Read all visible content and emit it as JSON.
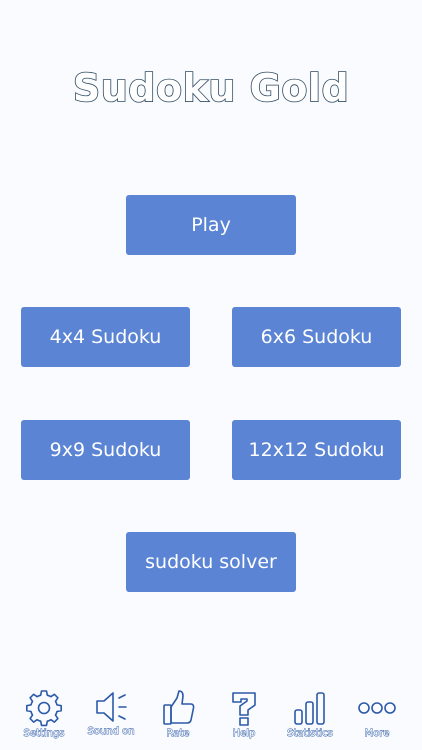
{
  "app": {
    "title": "Sudoku Gold"
  },
  "menu": {
    "play": "Play",
    "sudoku_4x4": "4x4 Sudoku",
    "sudoku_6x6": "6x6 Sudoku",
    "sudoku_9x9": "9x9 Sudoku",
    "sudoku_12x12": "12x12 Sudoku",
    "solver": "sudoku solver"
  },
  "toolbar": {
    "items": [
      {
        "label": "Settings",
        "icon": "gear-icon"
      },
      {
        "label": "Sound on",
        "icon": "speaker-icon"
      },
      {
        "label": "Rate",
        "icon": "thumbs-up-icon"
      },
      {
        "label": "Help",
        "icon": "question-mark-icon"
      },
      {
        "label": "Statistics",
        "icon": "bar-chart-icon"
      },
      {
        "label": "More",
        "icon": "more-dots-icon"
      }
    ]
  },
  "colors": {
    "background": "#f9fbfe",
    "button": "#5b84d4",
    "button_text": "#ffffff",
    "title_outline": "#2f4a60",
    "toolbar_icon": "#2c5aa8"
  }
}
